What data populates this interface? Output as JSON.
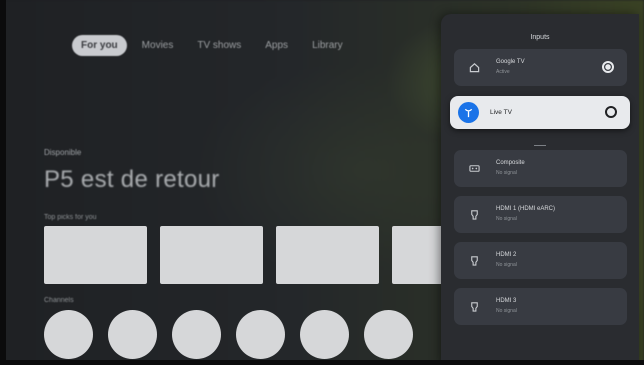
{
  "nav": {
    "tabs": [
      {
        "label": "For you",
        "active": true
      },
      {
        "label": "Movies",
        "active": false
      },
      {
        "label": "TV shows",
        "active": false
      },
      {
        "label": "Apps",
        "active": false
      },
      {
        "label": "Library",
        "active": false
      }
    ]
  },
  "hero": {
    "eyebrow": "Disponible",
    "title": "P5 est de retour"
  },
  "rows": {
    "cards_label": "Top picks for you",
    "circles_label": "Channels"
  },
  "inputs_panel": {
    "title": "Inputs",
    "items": [
      {
        "name": "Google TV",
        "status": "Active",
        "icon": "home-icon",
        "selected": false,
        "checked": true
      },
      {
        "name": "Live TV",
        "status": "",
        "icon": "antenna-icon",
        "selected": true,
        "checked": false
      },
      {
        "name": "Composite",
        "status": "No signal",
        "icon": "composite-icon",
        "selected": false,
        "checked": false
      },
      {
        "name": "HDMI 1 (HDMI eARC)",
        "status": "No signal",
        "icon": "hdmi-icon",
        "selected": false,
        "checked": false
      },
      {
        "name": "HDMI 2",
        "status": "No signal",
        "icon": "hdmi-icon",
        "selected": false,
        "checked": false
      },
      {
        "name": "HDMI 3",
        "status": "No signal",
        "icon": "hdmi-icon",
        "selected": false,
        "checked": false
      }
    ]
  },
  "colors": {
    "panel_bg": "#2a2c30",
    "item_bg": "#383b42",
    "selected_bg": "#e8eaed",
    "accent": "#1a73e8"
  }
}
